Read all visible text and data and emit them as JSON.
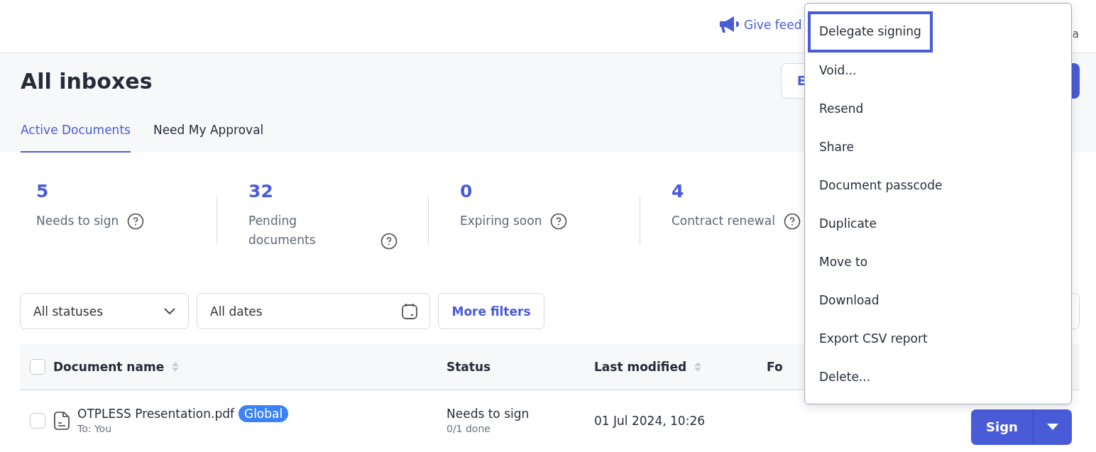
{
  "top_bar": {
    "feedback_link": "Give feed",
    "user_fragment": "a"
  },
  "header": {
    "title": "All inboxes",
    "secondary_button": "E",
    "tabs": [
      {
        "label": "Active Documents",
        "selected": true
      },
      {
        "label": "Need My Approval",
        "selected": false
      }
    ]
  },
  "stats": [
    {
      "value": "5",
      "label_lines": [
        "Needs to sign"
      ]
    },
    {
      "value": "32",
      "label_lines": [
        "Pending",
        "documents"
      ]
    },
    {
      "value": "0",
      "label_lines": [
        "Expiring soon"
      ]
    },
    {
      "value": "4",
      "label_lines": [
        "Contract renewal"
      ]
    }
  ],
  "filters": {
    "status_select": "All statuses",
    "date_field": "All dates",
    "more_button": "More filters"
  },
  "table": {
    "columns": [
      {
        "label": "Document name",
        "sortable": true
      },
      {
        "label": "Status",
        "sortable": false
      },
      {
        "label": "Last modified",
        "sortable": true
      },
      {
        "label": "Fo",
        "sortable": false
      }
    ],
    "header_checked": false,
    "rows": [
      {
        "checked": false,
        "name": "OTPLESS Presentation.pdf",
        "tag": "Global",
        "recipient": "To: You",
        "status": "Needs to sign",
        "progress": "0/1 done",
        "modified": "01 Jul 2024, 10:26",
        "action": "Sign"
      }
    ]
  },
  "menu": {
    "items": [
      {
        "label": "Delegate signing",
        "selected": true
      },
      {
        "label": "Void...",
        "selected": false
      },
      {
        "label": "Resend",
        "selected": false
      },
      {
        "label": "Share",
        "selected": false
      },
      {
        "label": "Document passcode",
        "selected": false
      },
      {
        "label": "Duplicate",
        "selected": false
      },
      {
        "label": "Move to",
        "selected": false
      },
      {
        "label": "Download",
        "selected": false
      },
      {
        "label": "Export CSV report",
        "selected": false
      },
      {
        "label": "Delete...",
        "selected": false
      }
    ]
  }
}
